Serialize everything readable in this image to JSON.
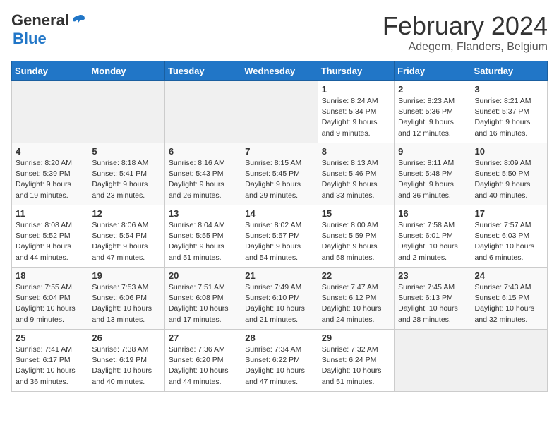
{
  "logo": {
    "general": "General",
    "blue": "Blue"
  },
  "title": "February 2024",
  "location": "Adegem, Flanders, Belgium",
  "days_header": [
    "Sunday",
    "Monday",
    "Tuesday",
    "Wednesday",
    "Thursday",
    "Friday",
    "Saturday"
  ],
  "weeks": [
    [
      {
        "day": "",
        "text": ""
      },
      {
        "day": "",
        "text": ""
      },
      {
        "day": "",
        "text": ""
      },
      {
        "day": "",
        "text": ""
      },
      {
        "day": "1",
        "text": "Sunrise: 8:24 AM\nSunset: 5:34 PM\nDaylight: 9 hours\nand 9 minutes."
      },
      {
        "day": "2",
        "text": "Sunrise: 8:23 AM\nSunset: 5:36 PM\nDaylight: 9 hours\nand 12 minutes."
      },
      {
        "day": "3",
        "text": "Sunrise: 8:21 AM\nSunset: 5:37 PM\nDaylight: 9 hours\nand 16 minutes."
      }
    ],
    [
      {
        "day": "4",
        "text": "Sunrise: 8:20 AM\nSunset: 5:39 PM\nDaylight: 9 hours\nand 19 minutes."
      },
      {
        "day": "5",
        "text": "Sunrise: 8:18 AM\nSunset: 5:41 PM\nDaylight: 9 hours\nand 23 minutes."
      },
      {
        "day": "6",
        "text": "Sunrise: 8:16 AM\nSunset: 5:43 PM\nDaylight: 9 hours\nand 26 minutes."
      },
      {
        "day": "7",
        "text": "Sunrise: 8:15 AM\nSunset: 5:45 PM\nDaylight: 9 hours\nand 29 minutes."
      },
      {
        "day": "8",
        "text": "Sunrise: 8:13 AM\nSunset: 5:46 PM\nDaylight: 9 hours\nand 33 minutes."
      },
      {
        "day": "9",
        "text": "Sunrise: 8:11 AM\nSunset: 5:48 PM\nDaylight: 9 hours\nand 36 minutes."
      },
      {
        "day": "10",
        "text": "Sunrise: 8:09 AM\nSunset: 5:50 PM\nDaylight: 9 hours\nand 40 minutes."
      }
    ],
    [
      {
        "day": "11",
        "text": "Sunrise: 8:08 AM\nSunset: 5:52 PM\nDaylight: 9 hours\nand 44 minutes."
      },
      {
        "day": "12",
        "text": "Sunrise: 8:06 AM\nSunset: 5:54 PM\nDaylight: 9 hours\nand 47 minutes."
      },
      {
        "day": "13",
        "text": "Sunrise: 8:04 AM\nSunset: 5:55 PM\nDaylight: 9 hours\nand 51 minutes."
      },
      {
        "day": "14",
        "text": "Sunrise: 8:02 AM\nSunset: 5:57 PM\nDaylight: 9 hours\nand 54 minutes."
      },
      {
        "day": "15",
        "text": "Sunrise: 8:00 AM\nSunset: 5:59 PM\nDaylight: 9 hours\nand 58 minutes."
      },
      {
        "day": "16",
        "text": "Sunrise: 7:58 AM\nSunset: 6:01 PM\nDaylight: 10 hours\nand 2 minutes."
      },
      {
        "day": "17",
        "text": "Sunrise: 7:57 AM\nSunset: 6:03 PM\nDaylight: 10 hours\nand 6 minutes."
      }
    ],
    [
      {
        "day": "18",
        "text": "Sunrise: 7:55 AM\nSunset: 6:04 PM\nDaylight: 10 hours\nand 9 minutes."
      },
      {
        "day": "19",
        "text": "Sunrise: 7:53 AM\nSunset: 6:06 PM\nDaylight: 10 hours\nand 13 minutes."
      },
      {
        "day": "20",
        "text": "Sunrise: 7:51 AM\nSunset: 6:08 PM\nDaylight: 10 hours\nand 17 minutes."
      },
      {
        "day": "21",
        "text": "Sunrise: 7:49 AM\nSunset: 6:10 PM\nDaylight: 10 hours\nand 21 minutes."
      },
      {
        "day": "22",
        "text": "Sunrise: 7:47 AM\nSunset: 6:12 PM\nDaylight: 10 hours\nand 24 minutes."
      },
      {
        "day": "23",
        "text": "Sunrise: 7:45 AM\nSunset: 6:13 PM\nDaylight: 10 hours\nand 28 minutes."
      },
      {
        "day": "24",
        "text": "Sunrise: 7:43 AM\nSunset: 6:15 PM\nDaylight: 10 hours\nand 32 minutes."
      }
    ],
    [
      {
        "day": "25",
        "text": "Sunrise: 7:41 AM\nSunset: 6:17 PM\nDaylight: 10 hours\nand 36 minutes."
      },
      {
        "day": "26",
        "text": "Sunrise: 7:38 AM\nSunset: 6:19 PM\nDaylight: 10 hours\nand 40 minutes."
      },
      {
        "day": "27",
        "text": "Sunrise: 7:36 AM\nSunset: 6:20 PM\nDaylight: 10 hours\nand 44 minutes."
      },
      {
        "day": "28",
        "text": "Sunrise: 7:34 AM\nSunset: 6:22 PM\nDaylight: 10 hours\nand 47 minutes."
      },
      {
        "day": "29",
        "text": "Sunrise: 7:32 AM\nSunset: 6:24 PM\nDaylight: 10 hours\nand 51 minutes."
      },
      {
        "day": "",
        "text": ""
      },
      {
        "day": "",
        "text": ""
      }
    ]
  ]
}
